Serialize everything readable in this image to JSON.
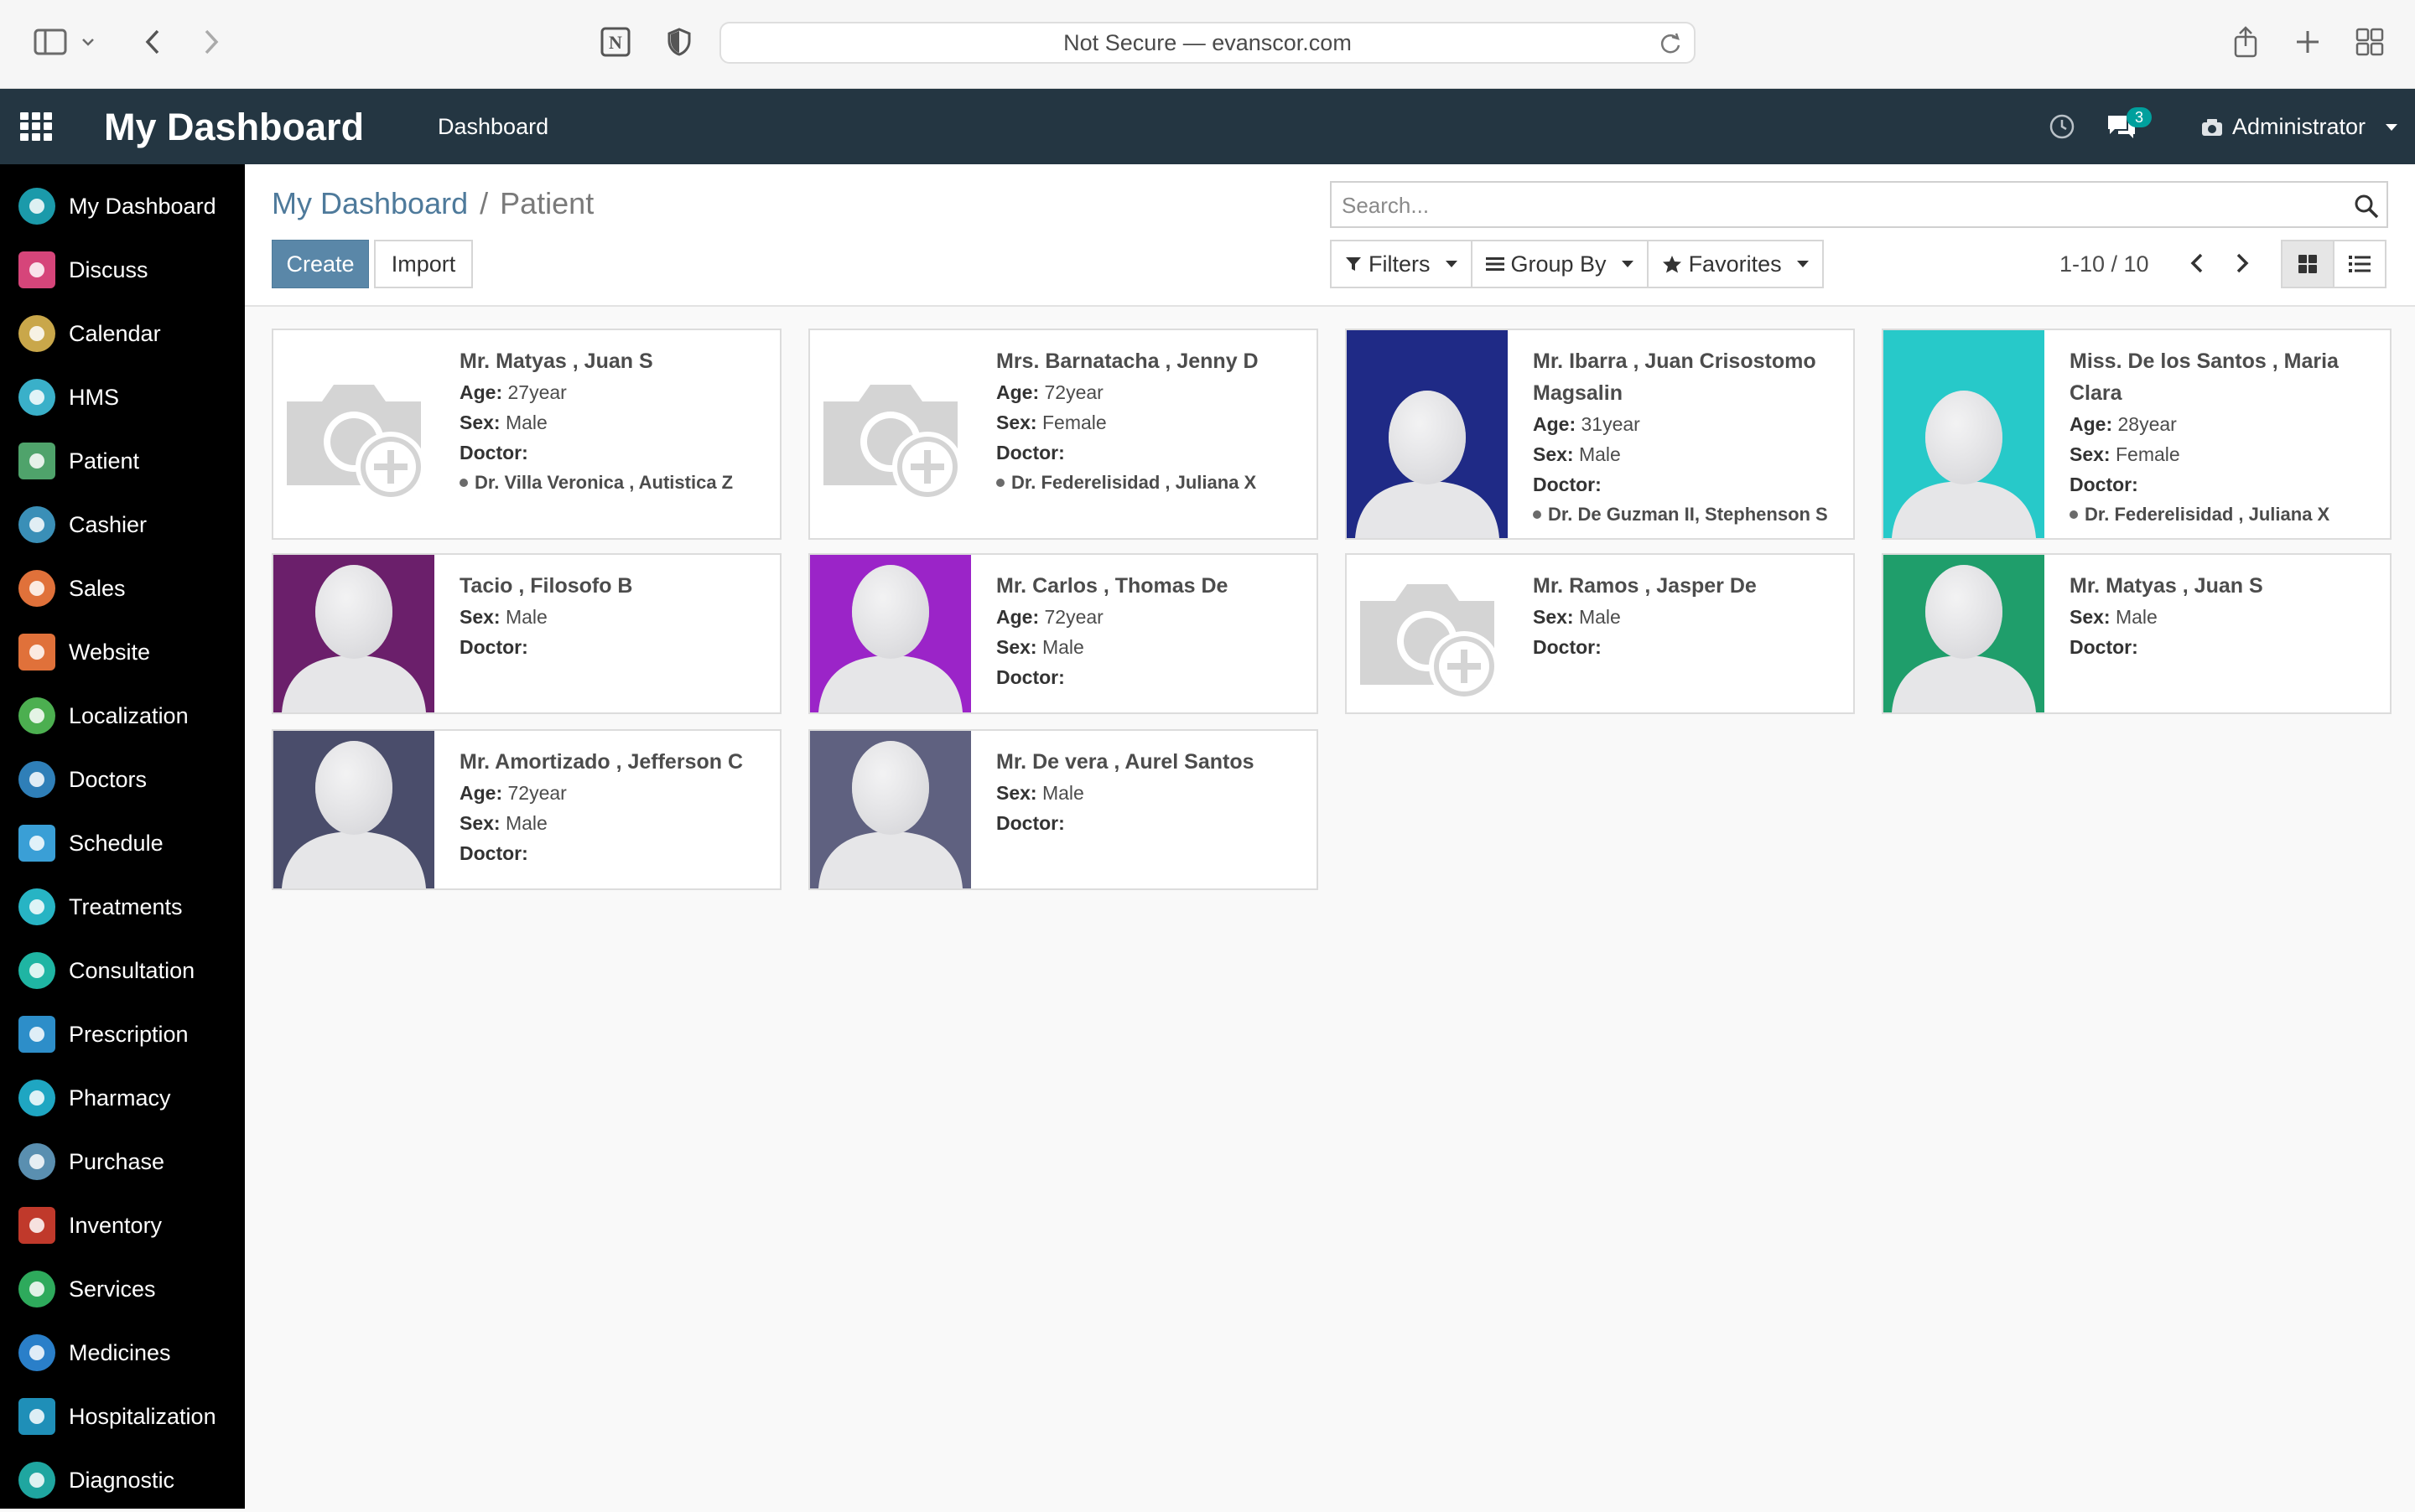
{
  "browser": {
    "url_text": "Not Secure — evanscor.com"
  },
  "topnav": {
    "brand": "My Dashboard",
    "menu_item": "Dashboard",
    "chat_count": "3",
    "user": "Administrator"
  },
  "sidebar": {
    "items": [
      {
        "label": "My Dashboard",
        "icon": "dashboard-icon",
        "color": "#1b9aaa"
      },
      {
        "label": "Discuss",
        "icon": "discuss-icon",
        "color": "#d6457a"
      },
      {
        "label": "Calendar",
        "icon": "calendar-icon",
        "color": "#c9a74a"
      },
      {
        "label": "HMS",
        "icon": "hms-icon",
        "color": "#3ab0c9"
      },
      {
        "label": "Patient",
        "icon": "patient-icon",
        "color": "#4fa36b"
      },
      {
        "label": "Cashier",
        "icon": "cashier-icon",
        "color": "#3a8fb7"
      },
      {
        "label": "Sales",
        "icon": "sales-icon",
        "color": "#e0713a"
      },
      {
        "label": "Website",
        "icon": "website-icon",
        "color": "#e0713a"
      },
      {
        "label": "Localization",
        "icon": "localization-icon",
        "color": "#4caf50"
      },
      {
        "label": "Doctors",
        "icon": "doctors-icon",
        "color": "#2f7fb8"
      },
      {
        "label": "Schedule",
        "icon": "schedule-icon",
        "color": "#3a9fd6"
      },
      {
        "label": "Treatments",
        "icon": "treatments-icon",
        "color": "#27b4c4"
      },
      {
        "label": "Consultation",
        "icon": "consultation-icon",
        "color": "#1fb5a3"
      },
      {
        "label": "Prescription",
        "icon": "prescription-icon",
        "color": "#2d8ec9"
      },
      {
        "label": "Pharmacy",
        "icon": "pharmacy-icon",
        "color": "#1fa6c2"
      },
      {
        "label": "Purchase",
        "icon": "purchase-icon",
        "color": "#5a8fb0"
      },
      {
        "label": "Inventory",
        "icon": "inventory-icon",
        "color": "#c0392b"
      },
      {
        "label": "Services",
        "icon": "services-icon",
        "color": "#2eaa5c"
      },
      {
        "label": "Medicines",
        "icon": "medicines-icon",
        "color": "#2a7fc9"
      },
      {
        "label": "Hospitalization",
        "icon": "hospitalization-icon",
        "color": "#1f8fb8"
      },
      {
        "label": "Diagnostic",
        "icon": "diagnostic-icon",
        "color": "#1fa6a0"
      }
    ]
  },
  "control": {
    "breadcrumb_root": "My Dashboard",
    "breadcrumb_sep": "/",
    "breadcrumb_current": "Patient",
    "create_label": "Create",
    "import_label": "Import",
    "search_placeholder": "Search...",
    "filters_label": "Filters",
    "groupby_label": "Group By",
    "favorites_label": "Favorites",
    "pager": "1-10 / 10"
  },
  "labels": {
    "age": "Age:",
    "sex": "Sex:",
    "doctor": "Doctor:"
  },
  "patients": [
    {
      "name": "Mr. Matyas , Juan S",
      "age": "27year",
      "sex": "Male",
      "doctor": "Dr. Villa Veronica , Autistica Z",
      "image": "placeholder",
      "bg": "#ffffff"
    },
    {
      "name": "Mrs. Barnatacha , Jenny D",
      "age": "72year",
      "sex": "Female",
      "doctor": "Dr. Federelisidad , Juliana X",
      "image": "placeholder",
      "bg": "#ffffff"
    },
    {
      "name": "Mr. Ibarra , Juan Crisostomo Magsalin",
      "age": "31year",
      "sex": "Male",
      "doctor": "Dr. De Guzman II, Stephenson S",
      "image": "avatar",
      "bg": "#1f2a86"
    },
    {
      "name": "Miss. De los Santos , Maria Clara",
      "age": "28year",
      "sex": "Female",
      "doctor": "Dr. Federelisidad , Juliana X",
      "image": "avatar",
      "bg": "#27c9c9"
    },
    {
      "name": "Tacio , Filosofo B",
      "age": "",
      "sex": "Male",
      "doctor": "",
      "image": "avatar",
      "bg": "#6b1f6b"
    },
    {
      "name": "Mr. Carlos , Thomas De",
      "age": "72year",
      "sex": "Male",
      "doctor": "",
      "image": "avatar",
      "bg": "#9b24c8"
    },
    {
      "name": "Mr. Ramos , Jasper De",
      "age": "",
      "sex": "Male",
      "doctor": "",
      "image": "placeholder",
      "bg": "#ffffff"
    },
    {
      "name": "Mr. Matyas , Juan S",
      "age": "",
      "sex": "Male",
      "doctor": "",
      "image": "avatar",
      "bg": "#1f9e6b"
    },
    {
      "name": "Mr. Amortizado , Jefferson C",
      "age": "72year",
      "sex": "Male",
      "doctor": "",
      "image": "avatar",
      "bg": "#4a4d6b"
    },
    {
      "name": "Mr. De vera , Aurel Santos",
      "age": "",
      "sex": "Male",
      "doctor": "",
      "image": "avatar",
      "bg": "#5f6180"
    }
  ]
}
